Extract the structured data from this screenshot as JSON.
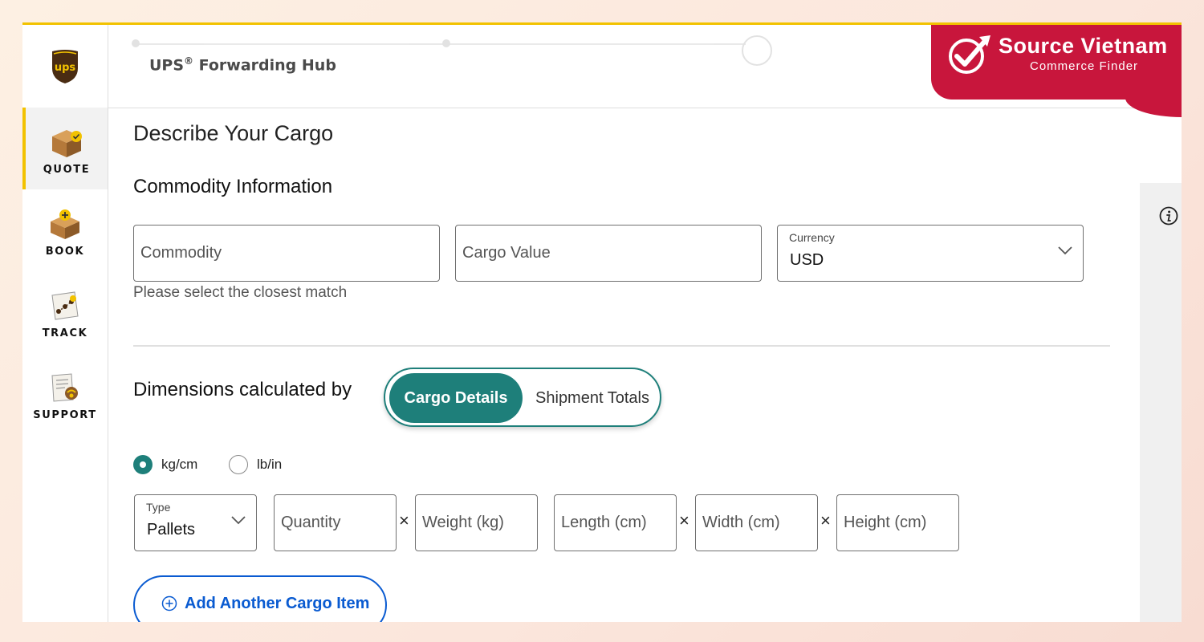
{
  "header": {
    "app_title": "UPS",
    "app_title_reg": "®",
    "app_title_rest": " Forwarding Hub",
    "logo_text": "ups"
  },
  "brand": {
    "name": "Source Vietnam",
    "tagline": "Commerce Finder",
    "color": "#c8163c"
  },
  "sidebar": {
    "items": [
      {
        "label": "QUOTE",
        "icon": "quote-box-icon",
        "active": true
      },
      {
        "label": "BOOK",
        "icon": "book-box-icon",
        "active": false
      },
      {
        "label": "TRACK",
        "icon": "track-icon",
        "active": false
      },
      {
        "label": "SUPPORT",
        "icon": "support-icon",
        "active": false
      }
    ]
  },
  "main": {
    "page_title": "Describe Your Cargo",
    "commodity_section": {
      "heading": "Commodity Information",
      "commodity_placeholder": "Commodity",
      "cargo_value_placeholder": "Cargo Value",
      "currency_label": "Currency",
      "currency_value": "USD",
      "hint": "Please select the closest match"
    },
    "dimensions": {
      "heading": "Dimensions calculated by",
      "toggle_selected": "Cargo Details",
      "toggle_other": "Shipment Totals",
      "units": [
        {
          "label": "kg/cm",
          "checked": true
        },
        {
          "label": "lb/in",
          "checked": false
        }
      ],
      "type_label": "Type",
      "type_value": "Pallets",
      "quantity_placeholder": "Quantity",
      "weight_placeholder": "Weight (kg)",
      "length_placeholder": "Length (cm)",
      "width_placeholder": "Width (cm)",
      "height_placeholder": "Height (cm)",
      "times": "×"
    },
    "add_button": "Add Another Cargo Item"
  },
  "colors": {
    "accent_teal": "#1e7f7a",
    "link_blue": "#0a5bd1",
    "ups_brown": "#4a2c12",
    "ups_gold": "#f2c200"
  }
}
